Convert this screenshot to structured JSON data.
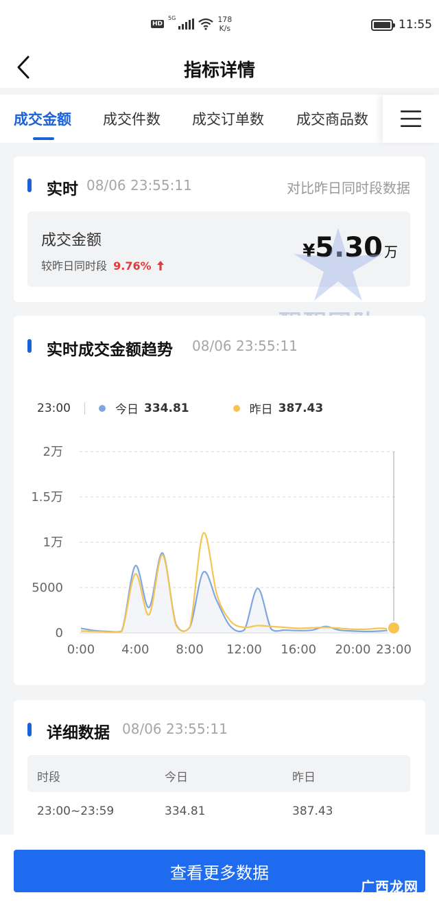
{
  "status_bar": {
    "network_badge": "HD",
    "signal_label": "5G",
    "speed_value": "178",
    "speed_unit": "K/s",
    "time": "11:55"
  },
  "nav": {
    "title": "指标详情"
  },
  "tabs": [
    {
      "label": "成交金额",
      "active": true
    },
    {
      "label": "成交件数",
      "active": false
    },
    {
      "label": "成交订单数",
      "active": false
    },
    {
      "label": "成交商品数",
      "active": false
    }
  ],
  "realtime": {
    "title": "实时",
    "timestamp": "08/06 23:55:11",
    "compare_link": "对比昨日同时段数据",
    "metric_label": "成交金额",
    "compare_text": "较昨日同时段",
    "compare_pct": "9.76%",
    "value_currency": "¥",
    "value_number": "5.30",
    "value_unit": "万"
  },
  "trend": {
    "title": "实时成交金额趋势",
    "timestamp": "08/06 23:55:11",
    "legend_time": "23:00",
    "today_label": "今日",
    "today_value": "334.81",
    "yesterday_label": "昨日",
    "yesterday_value": "387.43"
  },
  "chart_data": {
    "type": "line",
    "title": "",
    "xlabel": "",
    "ylabel": "",
    "x": [
      0,
      1,
      2,
      3,
      4,
      5,
      6,
      7,
      8,
      9,
      10,
      11,
      12,
      13,
      14,
      15,
      16,
      17,
      18,
      19,
      20,
      21,
      22,
      23
    ],
    "x_tick_labels": [
      "0:00",
      "4:00",
      "8:00",
      "12:00",
      "16:00",
      "20:00",
      "23:00"
    ],
    "x_tick_positions": [
      0,
      4,
      8,
      12,
      16,
      20,
      23
    ],
    "y_tick_labels": [
      "0",
      "5000",
      "1万",
      "1.5万",
      "2万"
    ],
    "y_tick_values": [
      0,
      5000,
      10000,
      15000,
      20000
    ],
    "ylim": [
      0,
      20000
    ],
    "grid": true,
    "series": [
      {
        "name": "今日",
        "color": "#7ea6e0",
        "values": [
          500,
          250,
          150,
          200,
          7400,
          2800,
          8800,
          900,
          600,
          6700,
          3500,
          700,
          300,
          4900,
          400,
          300,
          250,
          300,
          700,
          300,
          200,
          150,
          200,
          335
        ]
      },
      {
        "name": "昨日",
        "color": "#f5c451",
        "values": [
          200,
          150,
          100,
          150,
          6500,
          2000,
          8600,
          800,
          600,
          11000,
          4200,
          1300,
          600,
          800,
          700,
          600,
          500,
          550,
          600,
          500,
          400,
          400,
          500,
          387
        ]
      }
    ]
  },
  "detail": {
    "title": "详细数据",
    "timestamp": "08/06 23:55:11",
    "columns": [
      "时段",
      "今日",
      "昨日"
    ],
    "rows": [
      [
        "23:00~23:59",
        "334.81",
        "387.43"
      ]
    ]
  },
  "bottom": {
    "button_label": "查看更多数据",
    "watermark_text": "广西龙网"
  },
  "watermark": {
    "title": "醒醒团队",
    "subtitle": "XINGXING TEAM"
  },
  "colors": {
    "accent": "#1a62d8",
    "button": "#1f6bf0",
    "up": "#e33a3a",
    "today": "#7ea6e0",
    "yesterday": "#f5c451"
  }
}
